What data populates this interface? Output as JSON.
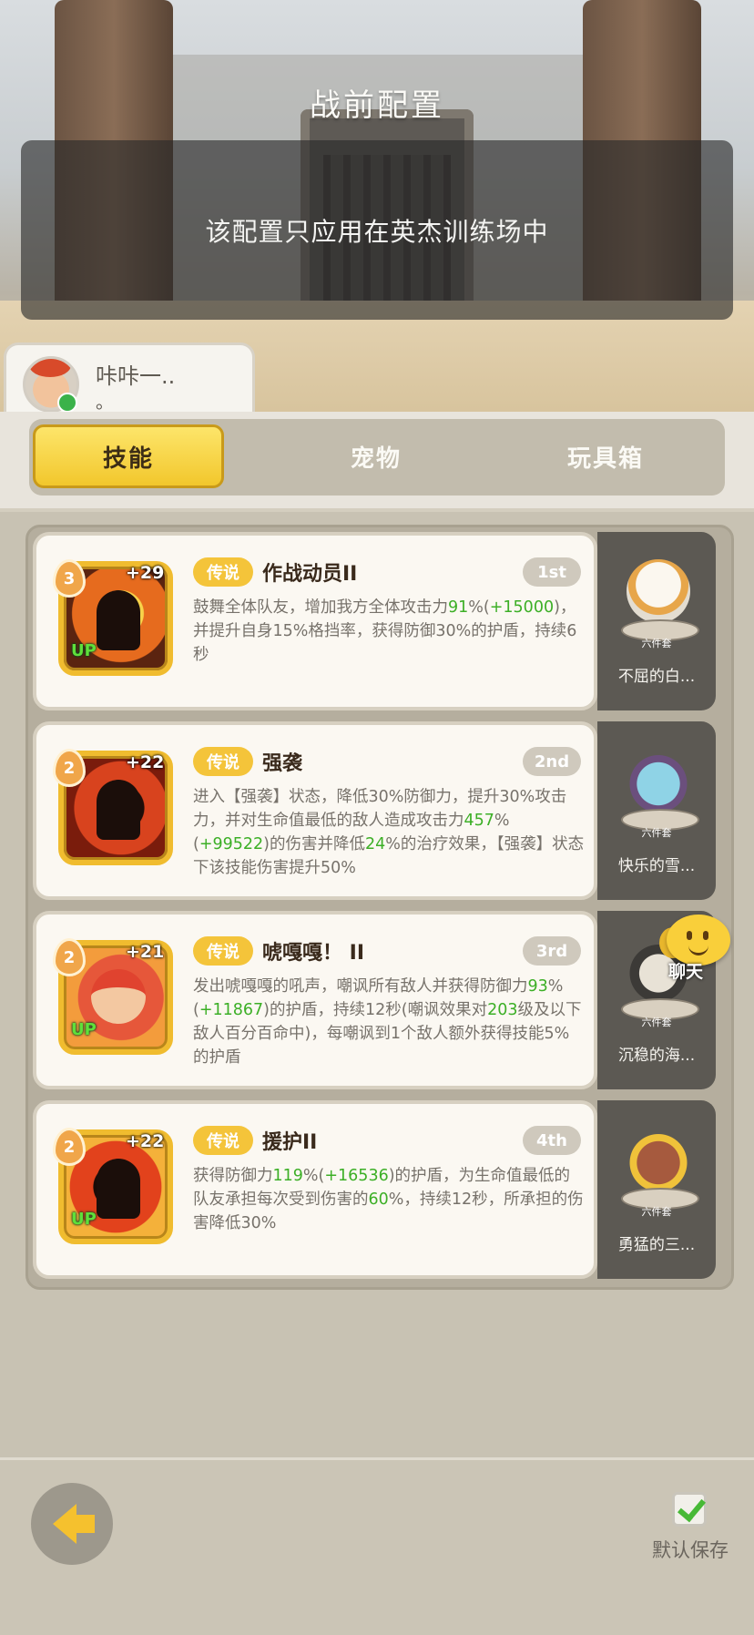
{
  "header": {
    "title": "战前配置",
    "notice": "该配置只应用在英杰训练场中"
  },
  "player": {
    "name": "咔咔一..",
    "sub": "。"
  },
  "tabs": [
    {
      "label": "技能",
      "active": true
    },
    {
      "label": "宠物",
      "active": false
    },
    {
      "label": "玩具箱",
      "active": false
    }
  ],
  "skills": [
    {
      "level": "3",
      "plus": "+29",
      "up": "UP",
      "rarity": "传说",
      "name": "作战动员II",
      "rank": "1st",
      "desc_parts": [
        {
          "t": "鼓舞全体队友，增加我方全体攻击力"
        },
        {
          "t": "91",
          "g": true
        },
        {
          "t": "%("
        },
        {
          "t": "+150",
          "g": true
        },
        {
          "t": "00",
          "g": true
        },
        {
          "t": ")，并提升自身15%格挡率，获得防御30%的护盾，持续6秒"
        }
      ],
      "pet": {
        "name": "不屈的白...",
        "set": "六件套"
      }
    },
    {
      "level": "2",
      "plus": "+22",
      "up": "",
      "rarity": "传说",
      "name": "强袭",
      "rank": "2nd",
      "desc_parts": [
        {
          "t": "进入【强袭】状态，降低30%防御力，提升30%攻击力，并对生命值最低的敌人造成攻击力"
        },
        {
          "t": "457",
          "g": true
        },
        {
          "t": "%("
        },
        {
          "t": "+99522",
          "g": true
        },
        {
          "t": ")的伤害并降低"
        },
        {
          "t": "24",
          "g": true
        },
        {
          "t": "%的治疗效果，【强袭】状态下该技能伤害提升50%"
        }
      ],
      "pet": {
        "name": "快乐的雪...",
        "set": "六件套"
      }
    },
    {
      "level": "2",
      "plus": "+21",
      "up": "UP",
      "rarity": "传说",
      "name": "唬嘎嘎！ II",
      "rank": "3rd",
      "desc_parts": [
        {
          "t": "发出唬嘎嘎的吼声，嘲讽所有敌人并获得防御力"
        },
        {
          "t": "93",
          "g": true
        },
        {
          "t": "%("
        },
        {
          "t": "+11867",
          "g": true
        },
        {
          "t": ")的护盾，持续12秒(嘲讽效果对"
        },
        {
          "t": "203",
          "g": true
        },
        {
          "t": "级及以下敌人百分百命中)，每嘲讽到1个敌人额外获得技能5%的护盾"
        }
      ],
      "pet": {
        "name": "沉稳的海...",
        "set": "六件套"
      }
    },
    {
      "level": "2",
      "plus": "+22",
      "up": "UP",
      "rarity": "传说",
      "name": "援护II",
      "rank": "4th",
      "desc_parts": [
        {
          "t": "获得防御力"
        },
        {
          "t": "119",
          "g": true
        },
        {
          "t": "%("
        },
        {
          "t": "+16536",
          "g": true
        },
        {
          "t": ")的护盾，为生命值最低的队友承担每次受到伤害的"
        },
        {
          "t": "60",
          "g": true
        },
        {
          "t": "%，持续12秒，所承担的伤害降低30%"
        }
      ],
      "pet": {
        "name": "勇猛的三...",
        "set": "六件套"
      }
    }
  ],
  "chat": {
    "label": "聊天"
  },
  "footer": {
    "save_label": "默认保存",
    "save_checked": true
  },
  "colors": {
    "accent_yellow": "#f2c72c",
    "highlight_green": "#3caf26",
    "rarity_gold": "#f4c43a"
  },
  "icons": {
    "back": "back-arrow-icon",
    "check": "check-icon",
    "chat": "chat-emoji-icon"
  }
}
